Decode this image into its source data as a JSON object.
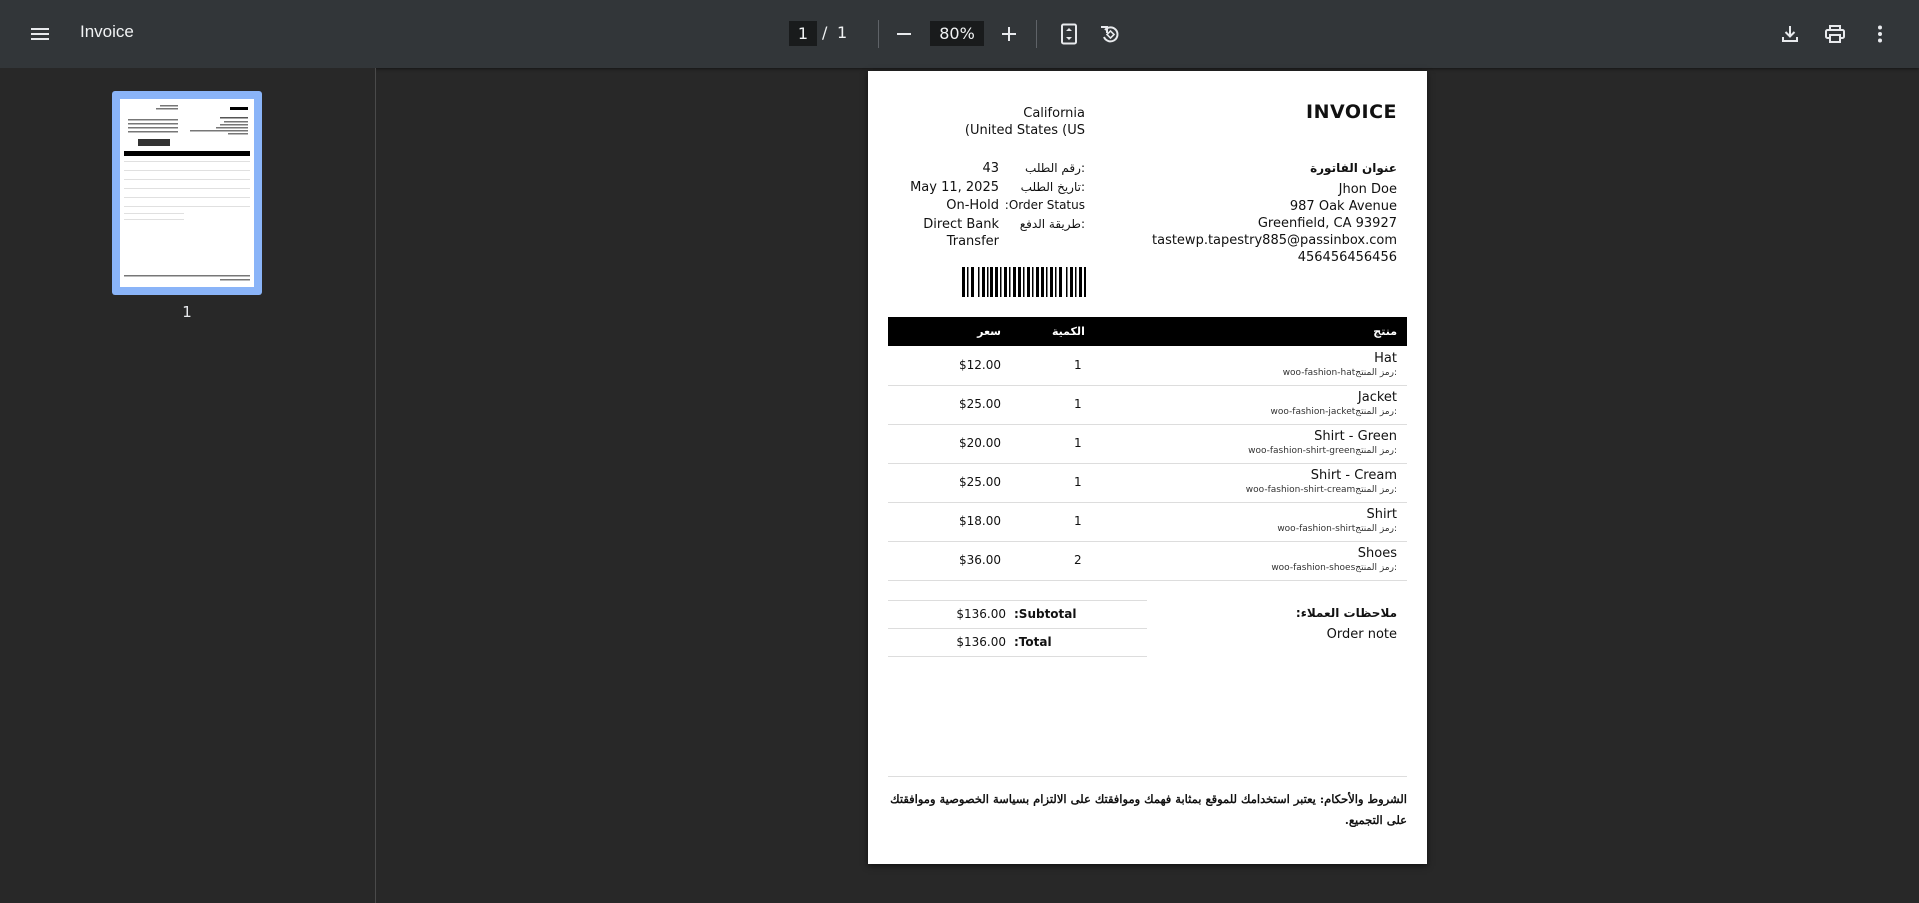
{
  "toolbar": {
    "title": "Invoice",
    "page_current": "1",
    "page_sep": "/",
    "page_total": "1",
    "zoom": "80%"
  },
  "sidebar": {
    "thumb_label": "1"
  },
  "invoice": {
    "title": "INVOICE",
    "shop_address": [
      "California",
      "(United States (US"
    ],
    "billing_heading": "عنوان الفاتورة",
    "billing_lines": [
      "Jhon Doe",
      "987 Oak Avenue",
      "Greenfield, CA 93927",
      "tastewp.tapestry885@passinbox.com",
      "456456456456"
    ],
    "meta": [
      {
        "label": "رقم الطلب:",
        "value": "43"
      },
      {
        "label": "تاريخ الطلب:",
        "value": "May 11, 2025"
      },
      {
        "label": ":Order Status",
        "value": "On-Hold"
      },
      {
        "label": "طريقة الدفع:",
        "value": "Direct Bank"
      }
    ],
    "payment_cont": "Transfer",
    "columns": {
      "product": "منتج",
      "qty": "الكمية",
      "price": "سعر"
    },
    "sku_label": "رمز المنتج:",
    "items": [
      {
        "name": "Hat",
        "sku": "woo-fashion-hat",
        "qty": "1",
        "price": "$12.00"
      },
      {
        "name": "Jacket",
        "sku": "woo-fashion-jacket",
        "qty": "1",
        "price": "$25.00"
      },
      {
        "name": "Shirt - Green",
        "sku": "woo-fashion-shirt-green",
        "qty": "1",
        "price": "$20.00"
      },
      {
        "name": "Shirt - Cream",
        "sku": "woo-fashion-shirt-cream",
        "qty": "1",
        "price": "$25.00"
      },
      {
        "name": "Shirt",
        "sku": "woo-fashion-shirt",
        "qty": "1",
        "price": "$18.00"
      },
      {
        "name": "Shoes",
        "sku": "woo-fashion-shoes",
        "qty": "2",
        "price": "$36.00"
      }
    ],
    "totals": [
      {
        "label": ":Subtotal",
        "value": "$136.00"
      },
      {
        "label": ":Total",
        "value": "$136.00"
      }
    ],
    "notes_heading": "ملاحظات العملاء:",
    "notes_value": "Order note",
    "terms": "الشروط والأحكام: يعتبر استخدامك للموقع بمثابة فهمك وموافقتك على الالتزام بسياسة الخصوصية وموافقتك على التجميع."
  }
}
